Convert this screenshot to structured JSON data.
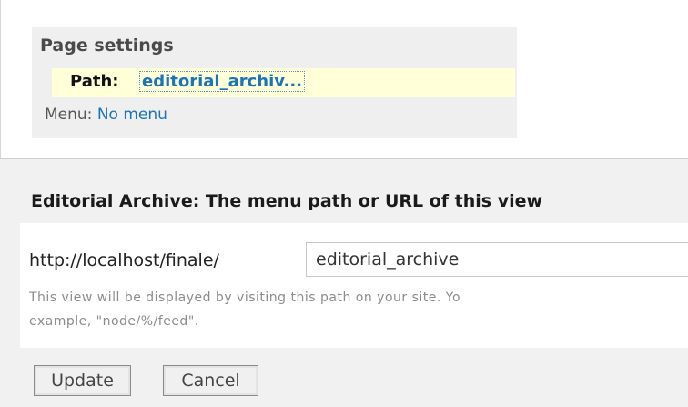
{
  "page_settings": {
    "title": "Page settings",
    "path_label": "Path:",
    "path_value": "editorial_archiv...",
    "menu_label": "Menu:",
    "menu_value": "No menu"
  },
  "form": {
    "title": "Editorial Archive: The menu path or URL of this view",
    "url_prefix": "http://localhost/finale/",
    "path_input_value": "editorial_archive",
    "help_line1": "This view will be displayed by visiting this path on your site. Yo",
    "help_line2": "example, \"node/%/feed\".",
    "update_label": "Update",
    "cancel_label": "Cancel"
  }
}
